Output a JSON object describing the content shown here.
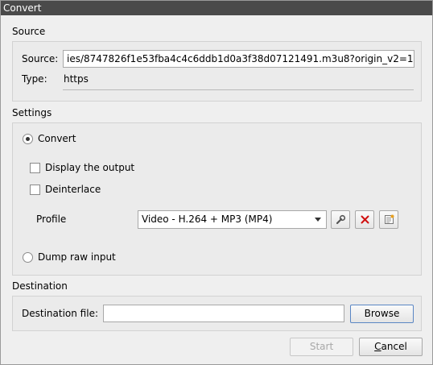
{
  "window": {
    "title": "Convert"
  },
  "source": {
    "section_title": "Source",
    "source_label": "Source:",
    "source_value": "ies/8747826f1e53fba4c4c6ddb1d0a3f38d07121491.m3u8?origin_v2=1",
    "type_label": "Type:",
    "type_value": "https"
  },
  "settings": {
    "section_title": "Settings",
    "convert_label": "Convert",
    "display_output_label": "Display the output",
    "deinterlace_label": "Deinterlace",
    "profile_label": "Profile",
    "profile_value": "Video - H.264 + MP3 (MP4)",
    "dump_raw_label": "Dump raw input"
  },
  "destination": {
    "section_title": "Destination",
    "file_label": "Destination file:",
    "file_value": "",
    "browse_label": "Browse"
  },
  "footer": {
    "start_label": "Start",
    "cancel_first": "C",
    "cancel_rest": "ancel"
  },
  "icons": {
    "edit_profile": "wrench-icon",
    "delete_profile": "red-x-icon",
    "new_profile": "document-icon",
    "delete_color": "#d01010"
  }
}
